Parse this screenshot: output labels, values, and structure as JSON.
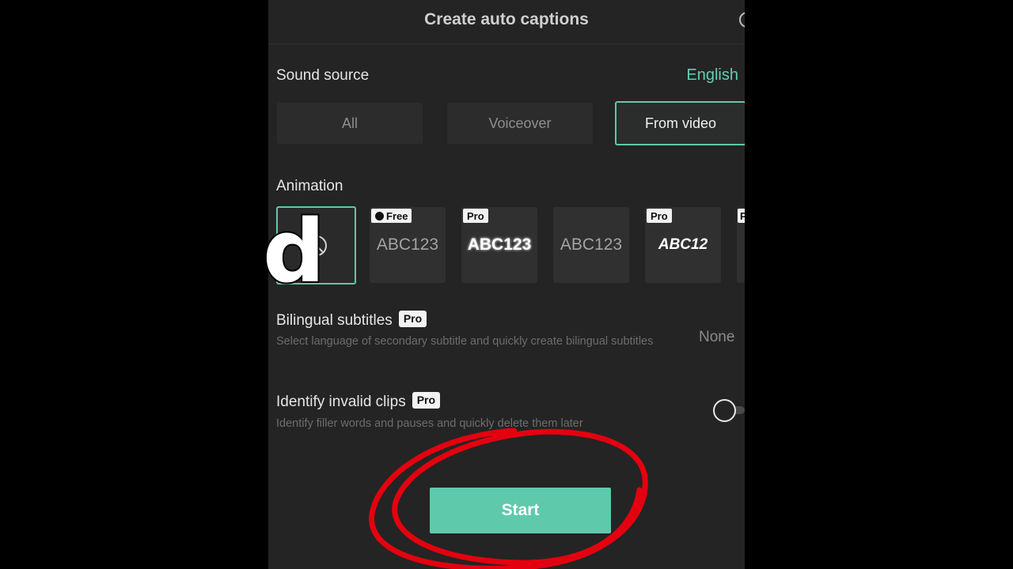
{
  "header": {
    "title": "Create auto captions"
  },
  "sound_source": {
    "label": "Sound source",
    "language": "English",
    "options": [
      "All",
      "Voiceover",
      "From video"
    ],
    "selected": "From video"
  },
  "animation": {
    "label": "Animation",
    "tiles": [
      {
        "badge": "",
        "text": "",
        "style": "none",
        "selected": true
      },
      {
        "badge": "Free",
        "text": "ABC123",
        "style": "plain"
      },
      {
        "badge": "Pro",
        "text": "ABC123",
        "style": "bold"
      },
      {
        "badge": "",
        "text": "ABC123",
        "style": "plain"
      },
      {
        "badge": "Pro",
        "text": "ABC12",
        "style": "italic"
      },
      {
        "badge": "P",
        "text": "",
        "style": "plain"
      }
    ]
  },
  "overlay_letter": "d",
  "bilingual": {
    "label": "Bilingual subtitles",
    "badge": "Pro",
    "description": "Select language of secondary subtitle and quickly create bilingual subtitles",
    "value": "None"
  },
  "invalid_clips": {
    "label": "Identify invalid clips",
    "badge": "Pro",
    "description": "Identify filler words and pauses and quickly delete them later",
    "enabled": false
  },
  "start_button": {
    "label": "Start"
  },
  "colors": {
    "accent": "#5fc9ac",
    "annotation": "#e4000f",
    "panel_bg": "#242424"
  }
}
